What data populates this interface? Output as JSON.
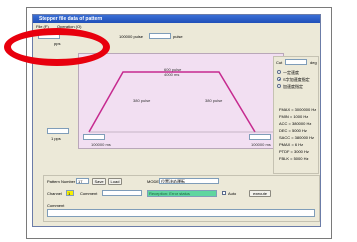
{
  "window": {
    "title": "Stepper file data of pattern",
    "menu": [
      "File (F)",
      "Operation (O)"
    ]
  },
  "graph": {
    "position_label": "100000 pulse",
    "position_value": "",
    "position_unit": "pulse",
    "top_field_value": "",
    "top_field_unit": "pps",
    "left_field_value": "",
    "left_field_unit": "pps",
    "peak_label_1": "600 pulse",
    "peak_label_2": "4000 ms",
    "accel_label": "380 pulse",
    "decel_label": "380 pulse",
    "accel_time_value": "",
    "accel_time_label": "100000 ms",
    "decel_time_value": "",
    "decel_time_label": "100000 ms",
    "start_speed_label": "1 pps"
  },
  "right_panel": {
    "field_label": "Cut",
    "field_value": "",
    "field_unit": "deg",
    "options": [
      {
        "label": "一定速度",
        "selected": false
      },
      {
        "label": "S字加速度指定",
        "selected": true
      },
      {
        "label": "加速度指定",
        "selected": false
      }
    ],
    "params": [
      "FMAX = 3000000 Hz",
      "FMIN = 1000 Hz",
      "ACC = 380000 Hz",
      "DEC = 5000 Hz",
      "SACC = 380000 Hz",
      "PMAX = 6 Hz",
      "PTDF = 3000 Hz",
      "FBLK = 5000 Hz"
    ]
  },
  "bottom": {
    "pattern_label": "Pattern Number",
    "pattern_value": "17",
    "save_label": "Save",
    "load_label": "Load",
    "mode_label": "MODE",
    "mode_value": "位置決め運転",
    "channel_label": "Channel",
    "channel_value": "1",
    "comment_label": "Comment",
    "comment_value": "",
    "status_text": "Reception: Error status",
    "auto_label": "Auto",
    "execute_label": "execute",
    "comment2_label": "Comment"
  },
  "colors": {
    "accent_line": "#c62a8f",
    "plot_fill": "#f2dff2",
    "highlight_ring": "#e8000d",
    "status_fill": "#5fd69f",
    "channel_fill": "#f7f000"
  }
}
